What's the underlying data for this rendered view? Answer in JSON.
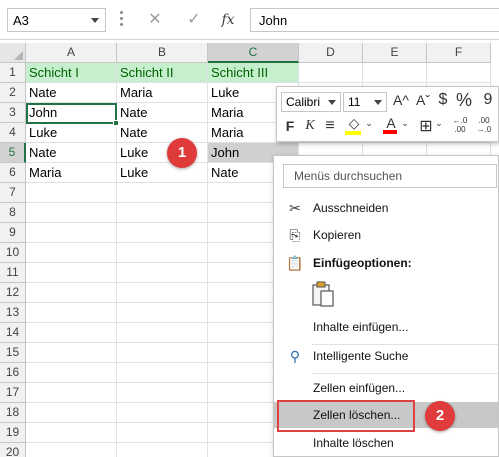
{
  "formula_bar": {
    "name_box": "A3",
    "cancel_icon": "✕",
    "enter_icon": "✓",
    "fx_label": "fx",
    "content": "John"
  },
  "columns": [
    "A",
    "B",
    "C",
    "D",
    "E",
    "F"
  ],
  "rows": [
    "1",
    "2",
    "3",
    "4",
    "5",
    "6",
    "7",
    "8",
    "9",
    "10",
    "11",
    "12",
    "13",
    "14",
    "15",
    "16",
    "17",
    "18",
    "19",
    "20"
  ],
  "cells": {
    "r1": [
      "Schicht I",
      "Schicht II",
      "Schicht III"
    ],
    "r2": [
      "Nate",
      "Maria",
      "Luke"
    ],
    "r3": [
      "John",
      "Nate",
      "Maria"
    ],
    "r4": [
      "Luke",
      "Nate",
      "Maria"
    ],
    "r5": [
      "Nate",
      "Luke",
      "John"
    ],
    "r6": [
      "Maria",
      "Luke",
      "Nate"
    ]
  },
  "mini_toolbar": {
    "font_name": "Calibri",
    "font_size": "11",
    "grow_font": "A^",
    "shrink_font": "Aˇ",
    "currency": "$",
    "percent": "%",
    "bold": "F",
    "italic": "K",
    "align": "≡",
    "fill_color_label": "◇",
    "font_color_label": "A",
    "borders": "⊞",
    "inc_decimal": "←.0\n.00",
    "dec_decimal": ".00\n→.0",
    "fill_color": "#FFFF00",
    "font_color": "#FF0000"
  },
  "context_menu": {
    "search_placeholder": "Menüs durchsuchen",
    "items": [
      {
        "label": "Ausschneiden",
        "icon": "scissors-icon"
      },
      {
        "label": "Kopieren",
        "icon": "copy-icon"
      },
      {
        "label": "Einfügeoptionen:",
        "icon": "paste-options-icon"
      },
      {
        "label": "Inhalte einfügen...",
        "icon": ""
      },
      {
        "label": "Intelligente Suche",
        "icon": "smart-lookup-icon"
      },
      {
        "label": "Zellen einfügen...",
        "icon": ""
      },
      {
        "label": "Zellen löschen...",
        "icon": ""
      },
      {
        "label": "Inhalte löschen",
        "icon": ""
      }
    ]
  },
  "callouts": [
    "1",
    "2"
  ],
  "colors": {
    "header_fill": "#C6EFCE",
    "header_text": "#006100",
    "selection_green": "#217346",
    "callout_red": "#E03B3B"
  }
}
